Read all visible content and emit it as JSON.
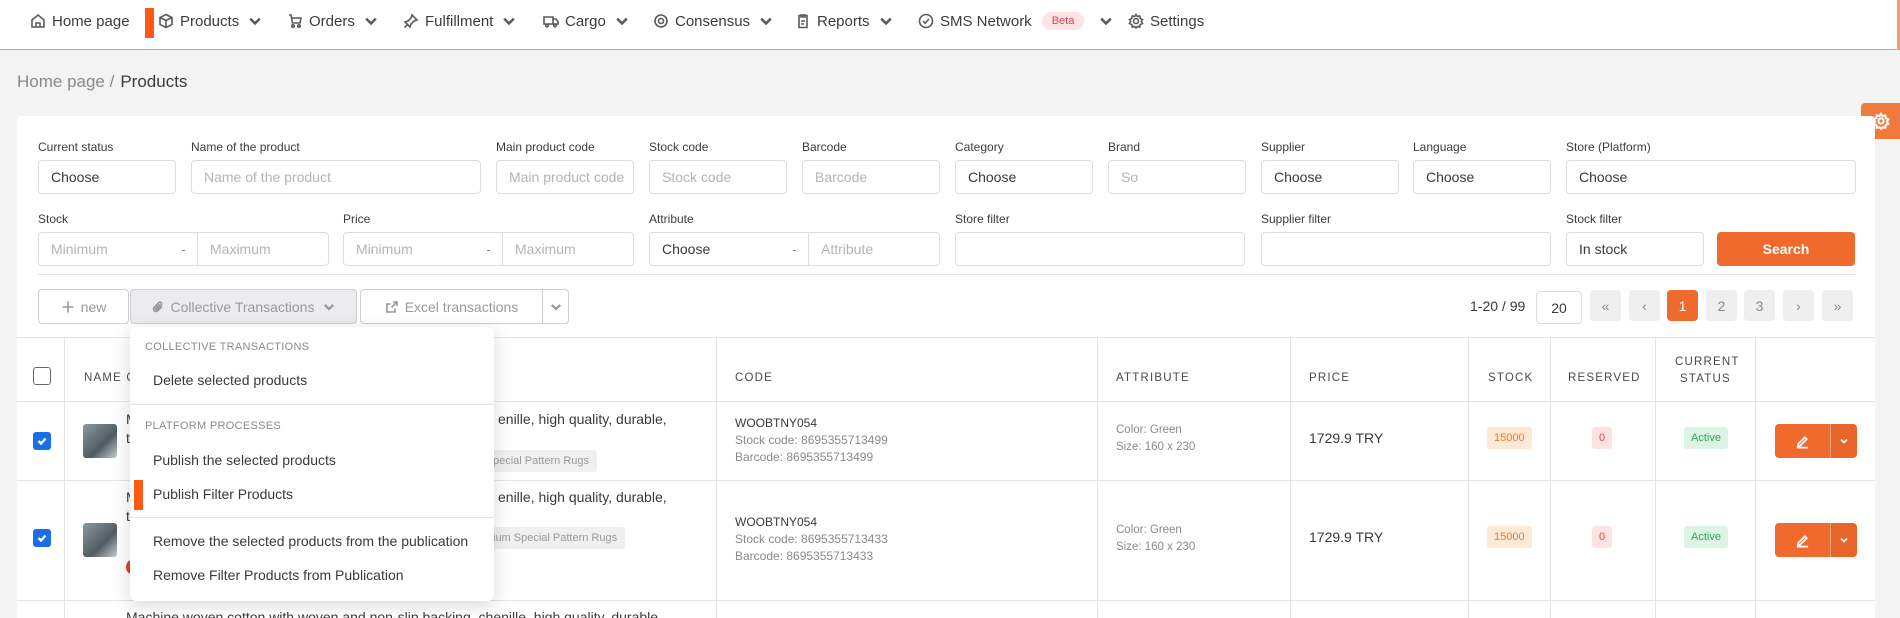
{
  "nav": {
    "items": [
      {
        "label": "Home page",
        "icon": "home-icon",
        "has_caret": false
      },
      {
        "label": "Products",
        "icon": "box-icon",
        "has_caret": true
      },
      {
        "label": "Orders",
        "icon": "orders-icon",
        "has_caret": true
      },
      {
        "label": "Fulfillment",
        "icon": "pin-icon",
        "has_caret": true
      },
      {
        "label": "Cargo",
        "icon": "truck-icon",
        "has_caret": true
      },
      {
        "label": "Consensus",
        "icon": "consensus-icon",
        "has_caret": true
      },
      {
        "label": "Reports",
        "icon": "clipboard-icon",
        "has_caret": true
      },
      {
        "label": "SMS Network",
        "icon": "check-circle-icon",
        "has_caret": true,
        "badge": "Beta"
      },
      {
        "label": "Settings",
        "icon": "gear-icon",
        "has_caret": false
      }
    ]
  },
  "breadcrumb": {
    "home": "Home page /",
    "current": "Products"
  },
  "filters": {
    "current_status": {
      "label": "Current status",
      "value": "Choose"
    },
    "product_name": {
      "label": "Name of the product",
      "placeholder": "Name of the product"
    },
    "main_code": {
      "label": "Main product code",
      "placeholder": "Main product code"
    },
    "stock_code": {
      "label": "Stock code",
      "placeholder": "Stock code"
    },
    "barcode": {
      "label": "Barcode",
      "placeholder": "Barcode"
    },
    "category": {
      "label": "Category",
      "value": "Choose"
    },
    "brand": {
      "label": "Brand",
      "placeholder": "So"
    },
    "supplier": {
      "label": "Supplier",
      "value": "Choose"
    },
    "language": {
      "label": "Language",
      "value": "Choose"
    },
    "store_platform": {
      "label": "Store (Platform)",
      "value": "Choose"
    },
    "stock": {
      "label": "Stock",
      "min_placeholder": "Minimum",
      "max_placeholder": "Maximum",
      "dash": "-"
    },
    "price": {
      "label": "Price",
      "min_placeholder": "Minimum",
      "max_placeholder": "Maximum",
      "dash": "-"
    },
    "attribute": {
      "label": "Attribute",
      "value": "Choose",
      "dash": "-",
      "placeholder": "Attribute"
    },
    "store_filter": {
      "label": "Store filter",
      "value": ""
    },
    "supplier_filter": {
      "label": "Supplier filter",
      "value": ""
    },
    "stock_filter": {
      "label": "Stock filter",
      "value": "In stock"
    },
    "search_label": "Search"
  },
  "toolbar": {
    "new_label": "new",
    "collective_label": "Collective Transactions",
    "excel_label": "Excel transactions"
  },
  "pagination": {
    "range": "1-20 / 99",
    "per_page": "20",
    "first": "«",
    "prev": "‹",
    "pages": [
      "1",
      "2",
      "3"
    ],
    "current": "1",
    "next": "›",
    "last": "»"
  },
  "table": {
    "headers": {
      "name": "NAME O",
      "code": "CODE",
      "attribute": "ATTRIBUTE",
      "price": "PRICE",
      "stock": "STOCK",
      "reserved": "RESERVED",
      "status_line1": "CURRENT",
      "status_line2": "STATUS"
    },
    "rows": [
      {
        "checked": true,
        "name_left_1": "M",
        "name_left_2": "t",
        "name_right": "enille, high quality, durable,",
        "tag": "pecial Pattern Rugs",
        "code": "WOOBTNY054",
        "stock_code": "Stock code: 8695355713499",
        "barcode": "Barcode: 8695355713499",
        "attr_color": "Color: Green",
        "attr_size": "Size: 160 x 230",
        "price": "1729.9 TRY",
        "stock": "15000",
        "reserved": "0",
        "status": "Active"
      },
      {
        "checked": true,
        "name_left_1": "M",
        "name_left_2": "t",
        "name_right": "enille, high quality, durable,",
        "tag": "ium Special Pattern Rugs",
        "code": "WOOBTNY054",
        "stock_code": "Stock code: 8695355713433",
        "barcode": "Barcode: 8695355713433",
        "attr_color": "Color: Green",
        "attr_size": "Size: 160 x 230",
        "price": "1729.9 TRY",
        "stock": "15000",
        "reserved": "0",
        "status": "Active"
      }
    ],
    "partial_row_text": "Machine woven cotton with woven and non-slip backing, chenille, high quality, durable"
  },
  "dropdown": {
    "section1": "COLLECTIVE TRANSACTIONS",
    "delete_selected": "Delete selected products",
    "section2": "PLATFORM PROCESSES",
    "publish_selected": "Publish the selected products",
    "publish_filter": "Publish Filter Products",
    "remove_selected": "Remove the selected products from the publication",
    "remove_filter": "Remove Filter Products from Publication"
  },
  "colors": {
    "accent": "#ef6a2c",
    "marker": "#ff5a14",
    "checkbox": "#1a6fe6"
  }
}
